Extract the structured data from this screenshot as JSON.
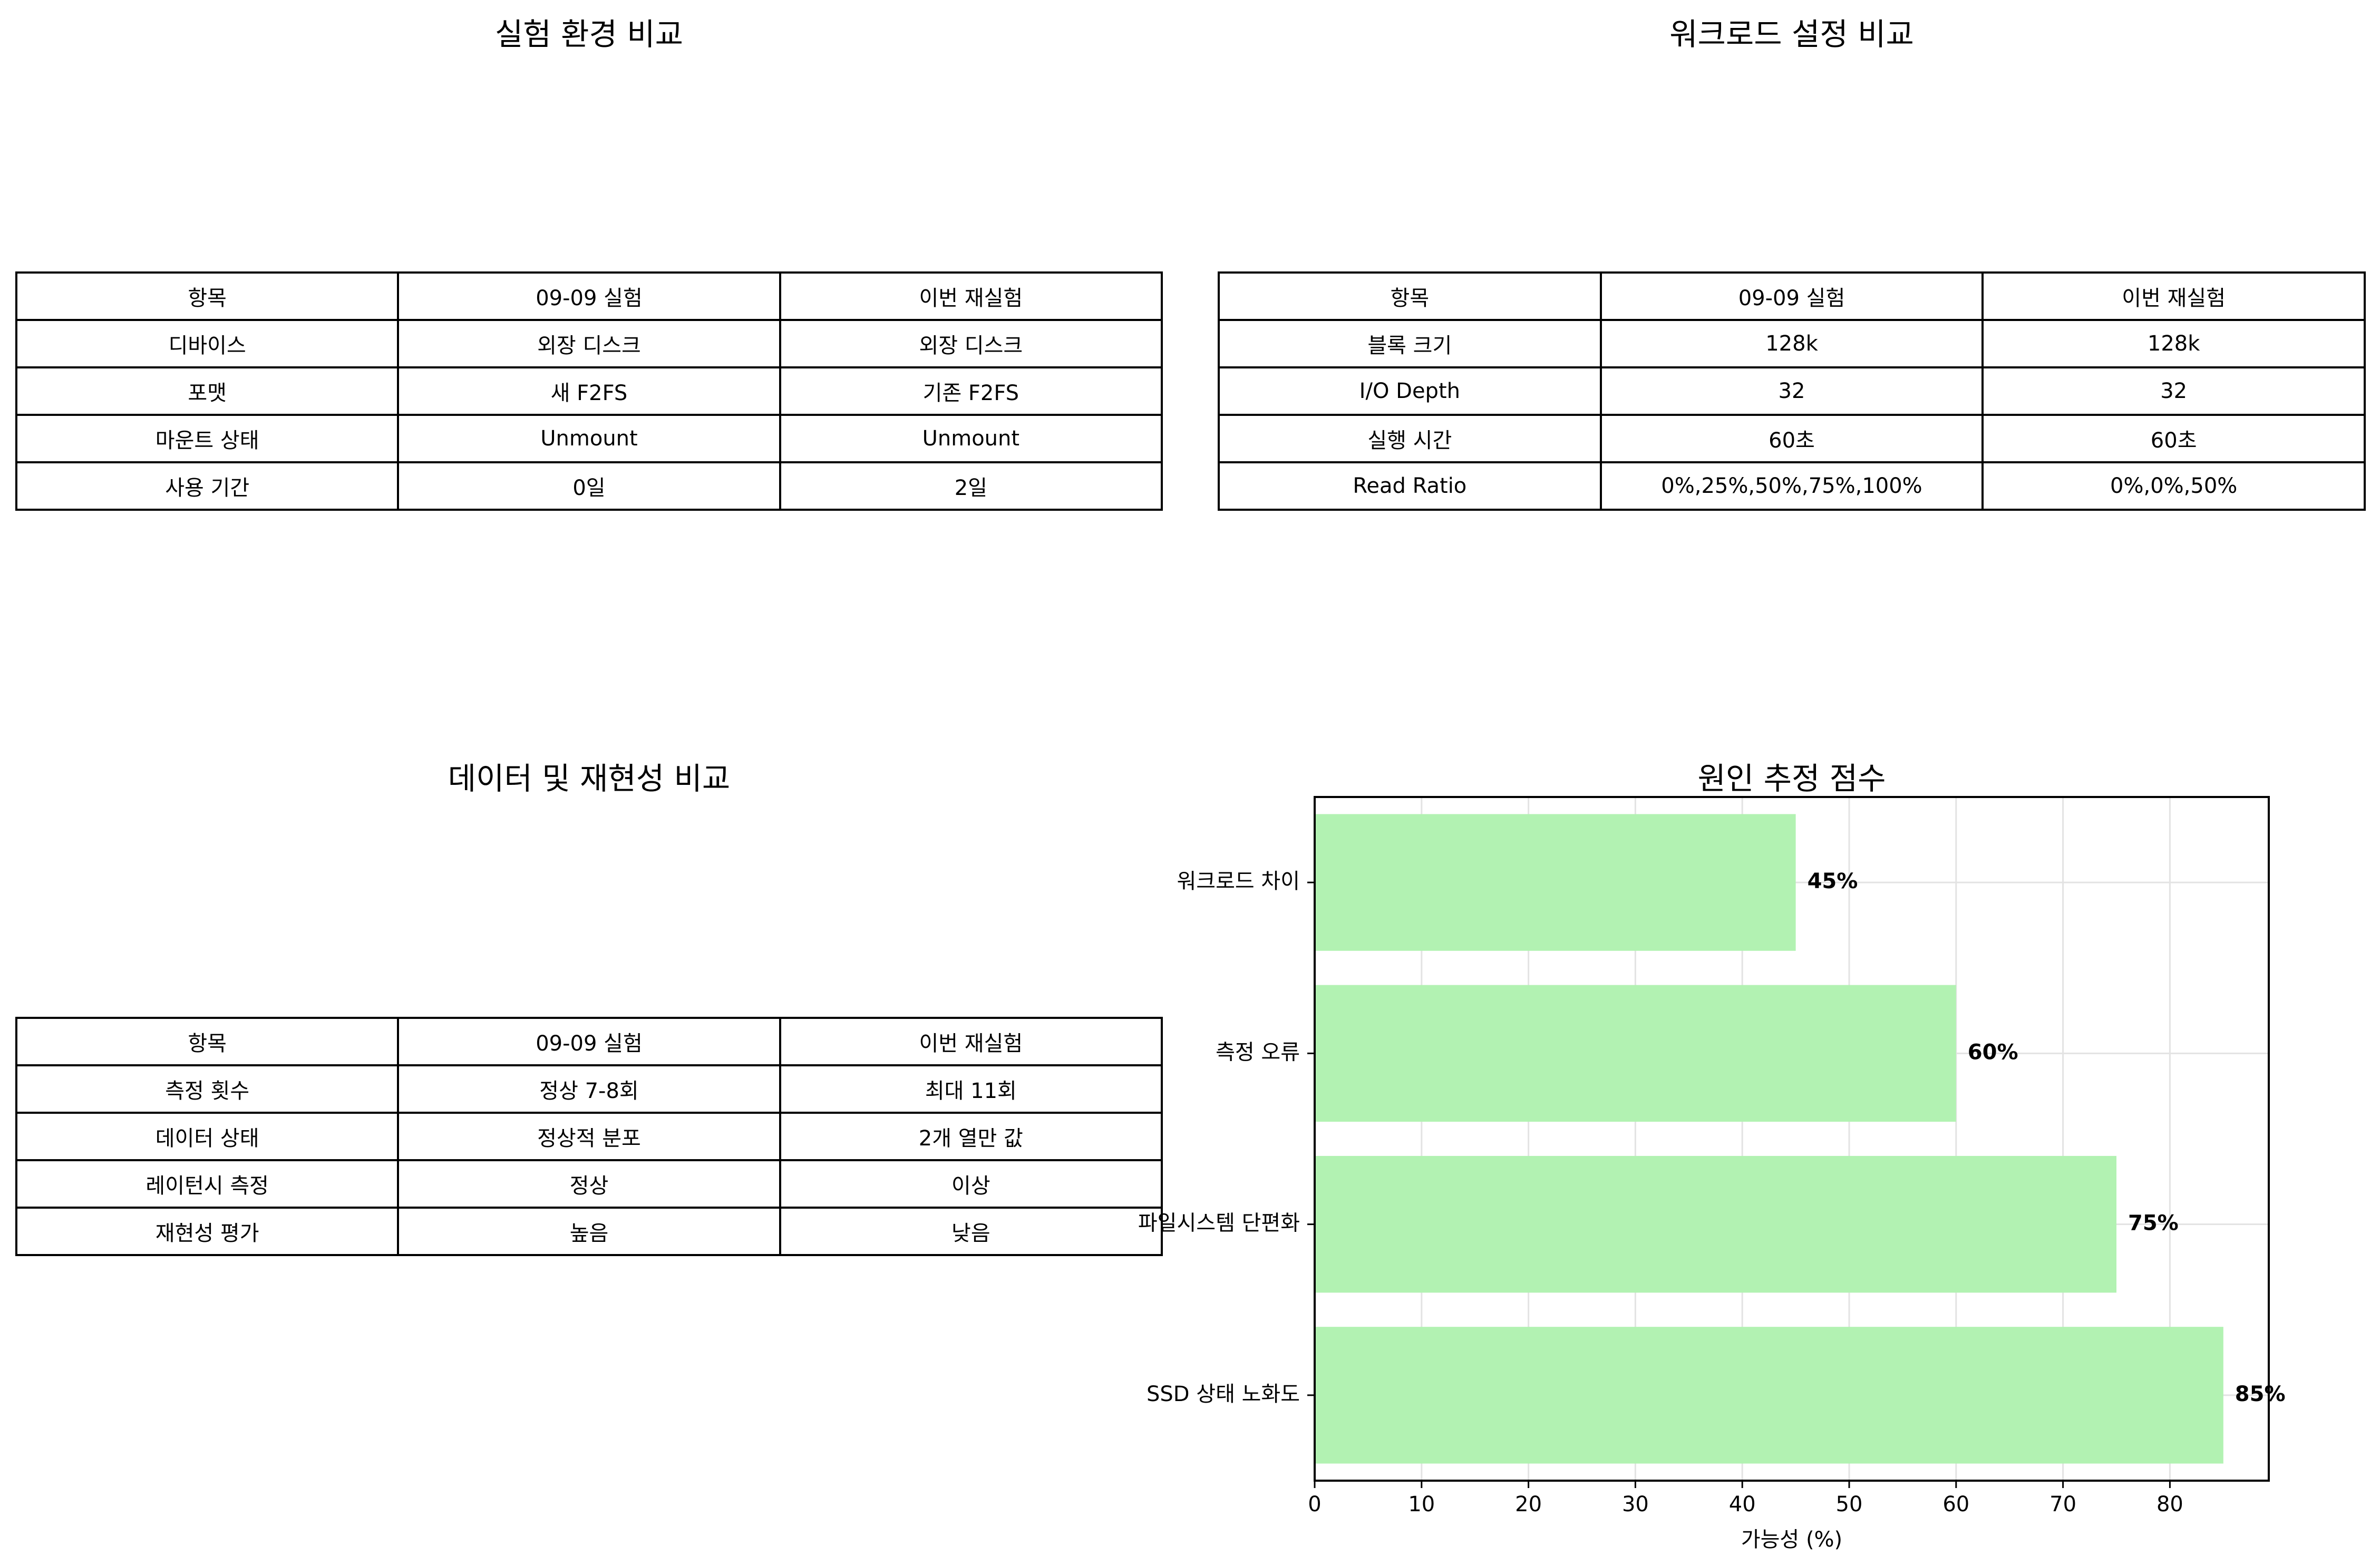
{
  "panels": {
    "environment": {
      "title": "실험 환경 비교",
      "rows": [
        [
          "항목",
          "09-09 실험",
          "이번 재실험"
        ],
        [
          "디바이스",
          "외장 디스크",
          "외장 디스크"
        ],
        [
          "포맷",
          "새 F2FS",
          "기존 F2FS"
        ],
        [
          "마운트 상태",
          "Unmount",
          "Unmount"
        ],
        [
          "사용 기간",
          "0일",
          "2일"
        ]
      ]
    },
    "workload": {
      "title": "워크로드 설정 비교",
      "rows": [
        [
          "항목",
          "09-09 실험",
          "이번 재실험"
        ],
        [
          "블록 크기",
          "128k",
          "128k"
        ],
        [
          "I/O Depth",
          "32",
          "32"
        ],
        [
          "실행 시간",
          "60초",
          "60초"
        ],
        [
          "Read Ratio",
          "0%,25%,50%,75%,100%",
          "0%,0%,50%"
        ]
      ]
    },
    "integrity": {
      "title": "데이터 및 재현성 비교",
      "rows": [
        [
          "항목",
          "09-09 실험",
          "이번 재실험"
        ],
        [
          "측정 횟수",
          "정상 7-8회",
          "최대 11회"
        ],
        [
          "데이터 상태",
          "정상적 분포",
          "2개 열만 값"
        ],
        [
          "레이턴시 측정",
          "정상",
          "이상"
        ],
        [
          "재현성 평가",
          "높음",
          "낮음"
        ]
      ]
    }
  },
  "chart_data": {
    "type": "bar",
    "orientation": "horizontal",
    "title": "원인 추정 점수",
    "xlabel": "가능성 (%)",
    "ylabel": "",
    "categories": [
      "SSD 상태 노화도",
      "파일시스템 단편화",
      "측정 오류",
      "워크로드 차이"
    ],
    "values": [
      85,
      75,
      60,
      45
    ],
    "value_labels": [
      "85%",
      "75%",
      "60%",
      "45%"
    ],
    "xlim": [
      0,
      89.25
    ],
    "xticks": [
      0,
      10,
      20,
      30,
      40,
      50,
      60,
      70,
      80
    ],
    "grid": true,
    "bar_color": "#b2f2b2"
  }
}
